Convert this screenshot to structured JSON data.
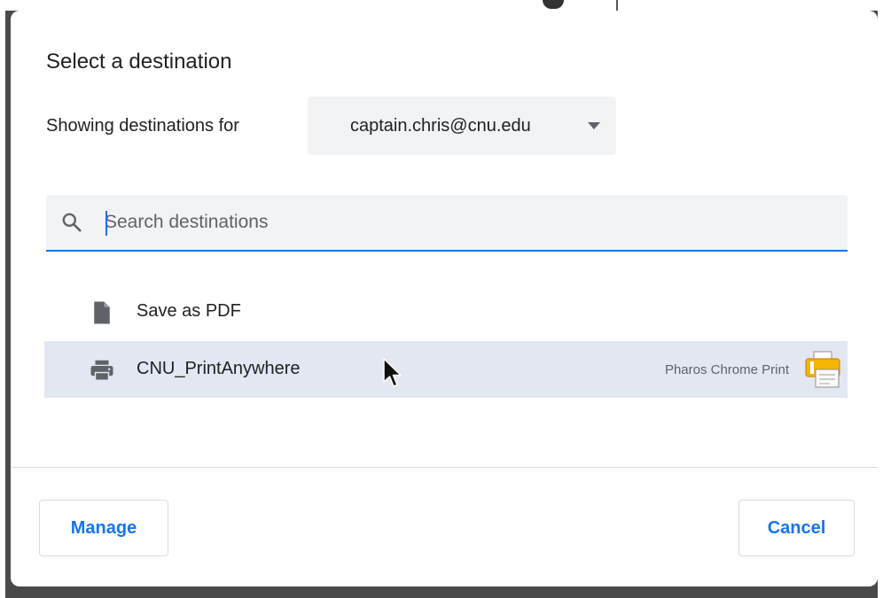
{
  "dialog": {
    "title": "Select a destination",
    "showing_label": "Showing destinations for",
    "account": "captain.chris@cnu.edu",
    "search": {
      "placeholder": "Search destinations",
      "value": ""
    },
    "destinations": [
      {
        "label": "Save as PDF",
        "icon": "pdf-file-icon",
        "extension": "",
        "selected": false
      },
      {
        "label": "CNU_PrintAnywhere",
        "icon": "printer-icon",
        "extension": "Pharos Chrome Print",
        "extension_icon": "pharos-printer-icon",
        "selected": true
      }
    ],
    "buttons": {
      "manage": "Manage",
      "cancel": "Cancel"
    }
  },
  "colors": {
    "accent": "#1a73e8",
    "selected_row": "#e3e7f1",
    "field_bg": "#f1f3f4"
  }
}
